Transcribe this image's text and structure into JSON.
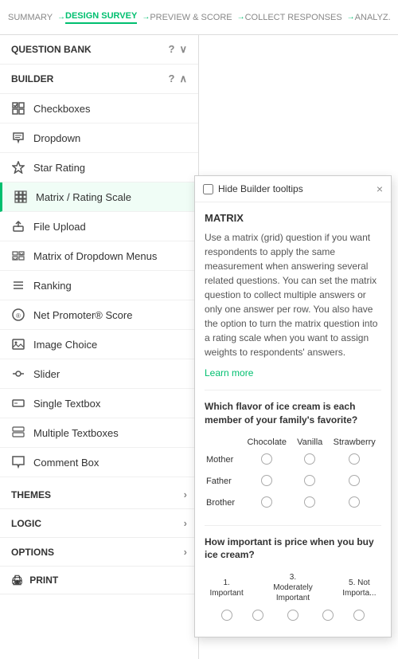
{
  "nav": {
    "items": [
      {
        "label": "SUMMARY",
        "active": false
      },
      {
        "label": "DESIGN SURVEY",
        "active": true
      },
      {
        "label": "PREVIEW & SCORE",
        "active": false
      },
      {
        "label": "COLLECT RESPONSES",
        "active": false
      },
      {
        "label": "ANALYZ.",
        "active": false
      }
    ]
  },
  "sidebar": {
    "questionBankLabel": "QUESTION BANK",
    "builderLabel": "BUILDER",
    "items": [
      {
        "label": "Checkboxes",
        "icon": "checkbox"
      },
      {
        "label": "Dropdown",
        "icon": "dropdown"
      },
      {
        "label": "Star Rating",
        "icon": "star"
      },
      {
        "label": "Matrix / Rating Scale",
        "icon": "matrix",
        "highlighted": true
      },
      {
        "label": "File Upload",
        "icon": "upload"
      },
      {
        "label": "Matrix of Dropdown Menus",
        "icon": "matrix2"
      },
      {
        "label": "Ranking",
        "icon": "ranking"
      },
      {
        "label": "Net Promoter® Score",
        "icon": "nps"
      },
      {
        "label": "Image Choice",
        "icon": "image"
      },
      {
        "label": "Slider",
        "icon": "slider"
      },
      {
        "label": "Single Textbox",
        "icon": "textbox"
      },
      {
        "label": "Multiple Textboxes",
        "icon": "textboxes"
      },
      {
        "label": "Comment Box",
        "icon": "comment"
      }
    ],
    "footer": [
      {
        "label": "THEMES"
      },
      {
        "label": "LOGIC"
      },
      {
        "label": "OPTIONS"
      },
      {
        "label": "PRINT"
      }
    ]
  },
  "tooltip": {
    "hideLabel": "Hide Builder tooltips",
    "closeChar": "×",
    "title": "MATRIX",
    "description": "Use a matrix (grid) question if you want respondents to apply the same measurement when answering several related questions. You can set the matrix question to collect multiple answers or only one answer per row. You also have the option to turn the matrix question into a rating scale when you want to assign weights to respondents' answers.",
    "learnMoreLabel": "Learn more",
    "example1": {
      "question": "Which flavor of ice cream is each member of your family's favorite?",
      "columns": [
        "",
        "Chocolate",
        "Vanilla",
        "Strawberry"
      ],
      "rows": [
        "Mother",
        "Father",
        "Brother"
      ]
    },
    "example2": {
      "question": "How important is price when you buy ice cream?",
      "columns": [
        "1.\nImportant",
        "3.\nModerately Important",
        "5. Not Importa..."
      ],
      "radioCount": 5
    }
  }
}
